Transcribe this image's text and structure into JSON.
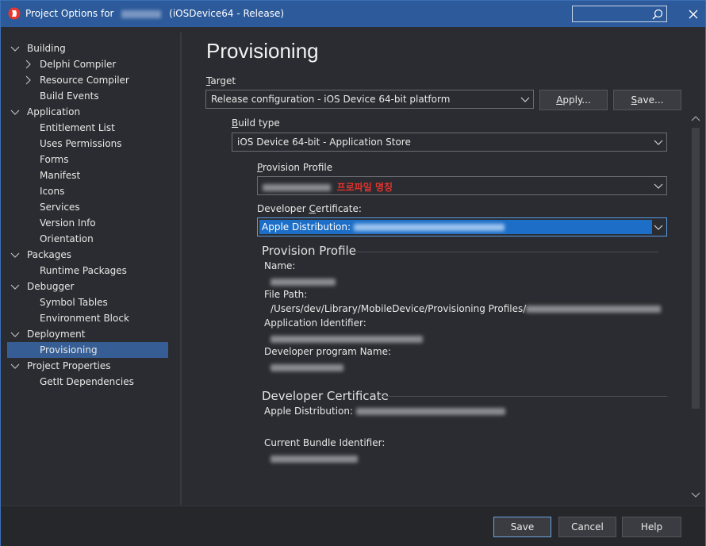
{
  "window": {
    "title_prefix": "Project Options for",
    "title_suffix": "(iOSDevice64 - Release)"
  },
  "sidebar": {
    "items": [
      {
        "label": "Building"
      },
      {
        "label": "Delphi Compiler"
      },
      {
        "label": "Resource Compiler"
      },
      {
        "label": "Build Events"
      },
      {
        "label": "Application"
      },
      {
        "label": "Entitlement List"
      },
      {
        "label": "Uses Permissions"
      },
      {
        "label": "Forms"
      },
      {
        "label": "Manifest"
      },
      {
        "label": "Icons"
      },
      {
        "label": "Services"
      },
      {
        "label": "Version Info"
      },
      {
        "label": "Orientation"
      },
      {
        "label": "Packages"
      },
      {
        "label": "Runtime Packages"
      },
      {
        "label": "Debugger"
      },
      {
        "label": "Symbol Tables"
      },
      {
        "label": "Environment Block"
      },
      {
        "label": "Deployment"
      },
      {
        "label": "Provisioning"
      },
      {
        "label": "Project Properties"
      },
      {
        "label": "GetIt Dependencies"
      }
    ]
  },
  "main": {
    "title": "Provisioning",
    "target": {
      "label_u": "T",
      "label_rest": "arget",
      "value": "Release configuration - iOS Device 64-bit platform",
      "apply_u": "A",
      "apply_rest": "pply...",
      "save_u": "S",
      "save_rest": "ave..."
    },
    "build_type": {
      "label_u": "B",
      "label_rest": "uild type",
      "value": "iOS Device 64-bit - Application Store"
    },
    "provision_profile": {
      "label_u": "P",
      "label_rest": "rovision Profile",
      "annotation": "프로파일 명칭"
    },
    "developer_certificate": {
      "label_pre": "Developer ",
      "label_u": "C",
      "label_rest": "ertificate:",
      "value_prefix": "Apple Distribution:"
    },
    "provision_profile_section": {
      "heading": "Provision Profile",
      "name_label": "Name:",
      "file_path_label": "File Path:",
      "file_path_value": "/Users/dev/Library/MobileDevice/Provisioning Profiles/",
      "app_id_label": "Application Identifier:",
      "dev_program_label": "Developer program Name:"
    },
    "developer_certificate_section": {
      "heading": "Developer Certificate",
      "apple_dist_label": "Apple Distribution:",
      "bundle_id_label": "Current Bundle Identifier:"
    }
  },
  "footer": {
    "save": "Save",
    "cancel": "Cancel",
    "help": "Help"
  },
  "colors": {
    "titlebar": "#2c5a9a",
    "selection": "#365e94",
    "focus_fill": "#1d6ec6",
    "annotation_red": "#e0332d"
  }
}
